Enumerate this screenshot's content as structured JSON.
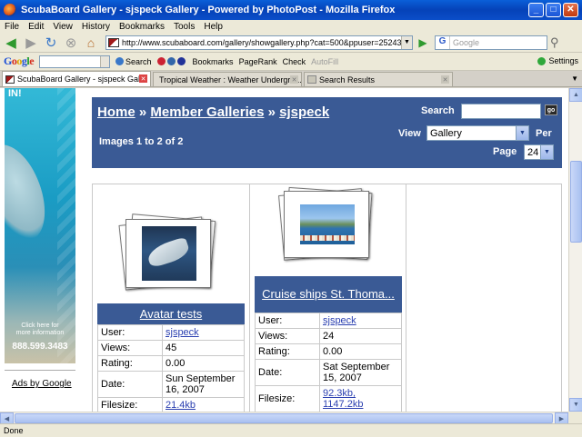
{
  "window": {
    "title": "ScubaBoard Gallery - sjspeck Gallery - Powered by PhotoPost - Mozilla Firefox",
    "minimize": "_",
    "maximize": "□",
    "close": "✕"
  },
  "menu": [
    "File",
    "Edit",
    "View",
    "History",
    "Bookmarks",
    "Tools",
    "Help"
  ],
  "nav": {
    "url": "http://www.scubaboard.com/gallery/showgallery.php?cat=500&ppuser=25243",
    "search_placeholder": "Google"
  },
  "google_toolbar": {
    "search": "Search",
    "bookmarks": "Bookmarks",
    "pagerank": "PageRank",
    "check": "Check",
    "autofill": "AutoFill",
    "settings": "Settings"
  },
  "tabs": [
    {
      "label": "ScubaBoard Gallery - sjspeck Gal...",
      "active": true
    },
    {
      "label": "Tropical Weather : Weather Undergro...",
      "active": false
    },
    {
      "label": "Search Results",
      "active": false
    }
  ],
  "ad": {
    "top": "IN!",
    "click_line1": "Click here for",
    "click_line2": "more information",
    "phone": "888.599.3483",
    "ads_by": "Ads by Google"
  },
  "header": {
    "crumb_home": "Home",
    "crumb_sep1": "»",
    "crumb_members": "Member Galleries",
    "crumb_sep2": "»",
    "crumb_user": "sjspeck",
    "image_count": "Images 1 to 2 of 2",
    "search_label": "Search",
    "go_button": "go",
    "view_label": "View",
    "view_value": "Gallery",
    "per_label": "Per",
    "page_label": "Page",
    "page_value": "24"
  },
  "gallery": [
    {
      "title": "Avatar tests",
      "labels": {
        "user": "User:",
        "views": "Views:",
        "rating": "Rating:",
        "date": "Date:",
        "filesize": "Filesize:"
      },
      "user": "sjspeck",
      "views": "45",
      "rating": "0.00",
      "date": "Sun September 16, 2007",
      "filesize": "21.4kb"
    },
    {
      "title": "Cruise ships St. Thoma...",
      "labels": {
        "user": "User:",
        "views": "Views:",
        "rating": "Rating:",
        "date": "Date:",
        "filesize": "Filesize:"
      },
      "user": "sjspeck",
      "views": "24",
      "rating": "0.00",
      "date": "Sat September 15, 2007",
      "filesize": "92.3kb, 1147.2kb"
    }
  ],
  "status": "Done"
}
